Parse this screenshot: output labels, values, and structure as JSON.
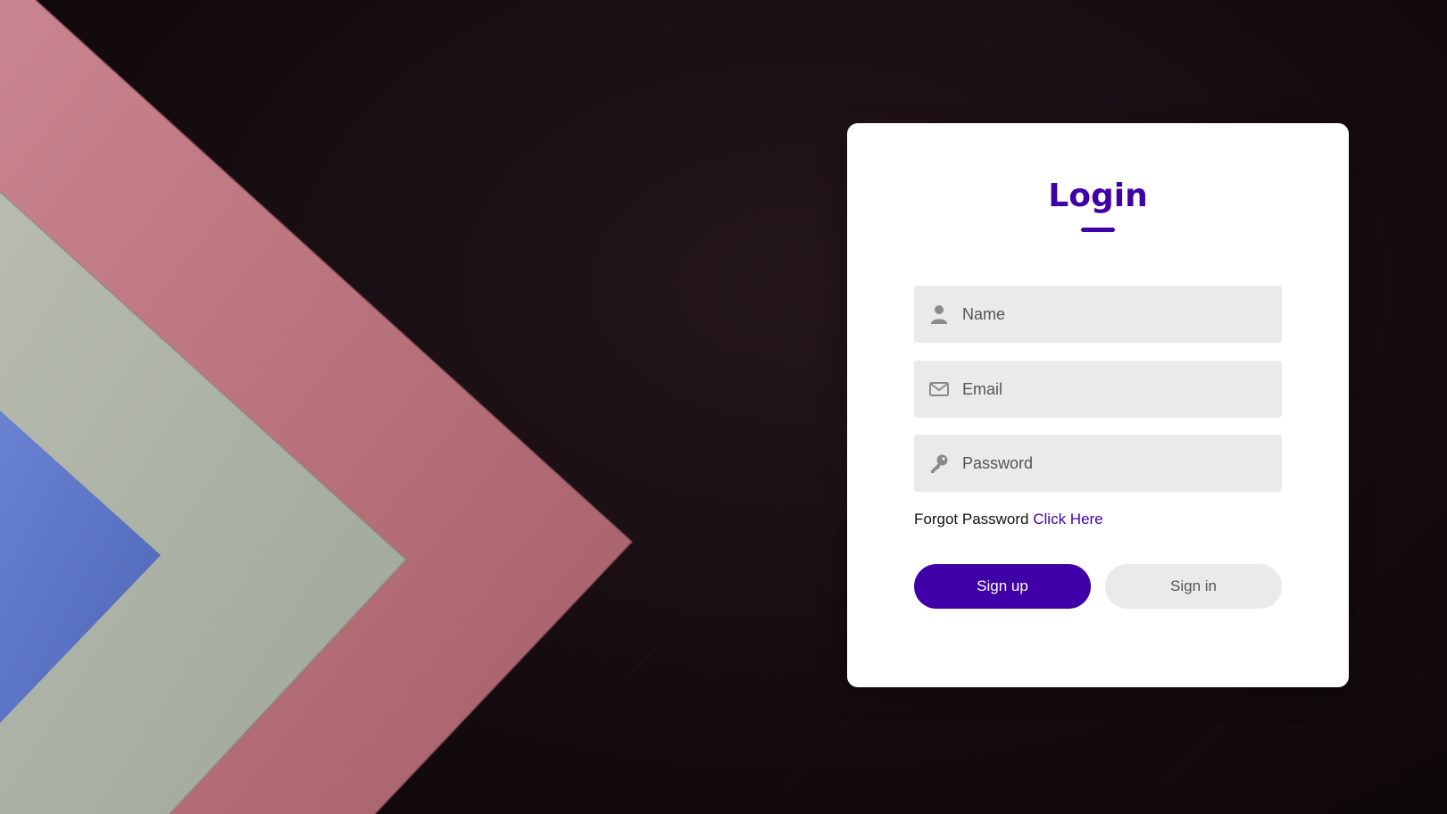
{
  "form": {
    "title": "Login",
    "name_placeholder": "Name",
    "email_placeholder": "Email",
    "password_placeholder": "Password",
    "forgot_text": "Forgot Password",
    "forgot_link": "Click Here",
    "signup_label": "Sign up",
    "signin_label": "Sign in"
  },
  "icons": {
    "name_field": "user-icon",
    "email_field": "envelope-icon",
    "password_field": "key-icon"
  },
  "colors": {
    "accent": "#3f00a8",
    "field_background": "#eaeaea",
    "card_background": "#ffffff",
    "page_background": "#160c10",
    "paper_pink": "#b9747c",
    "paper_grey": "#a7aea2",
    "paper_blue": "#5a72c4"
  }
}
